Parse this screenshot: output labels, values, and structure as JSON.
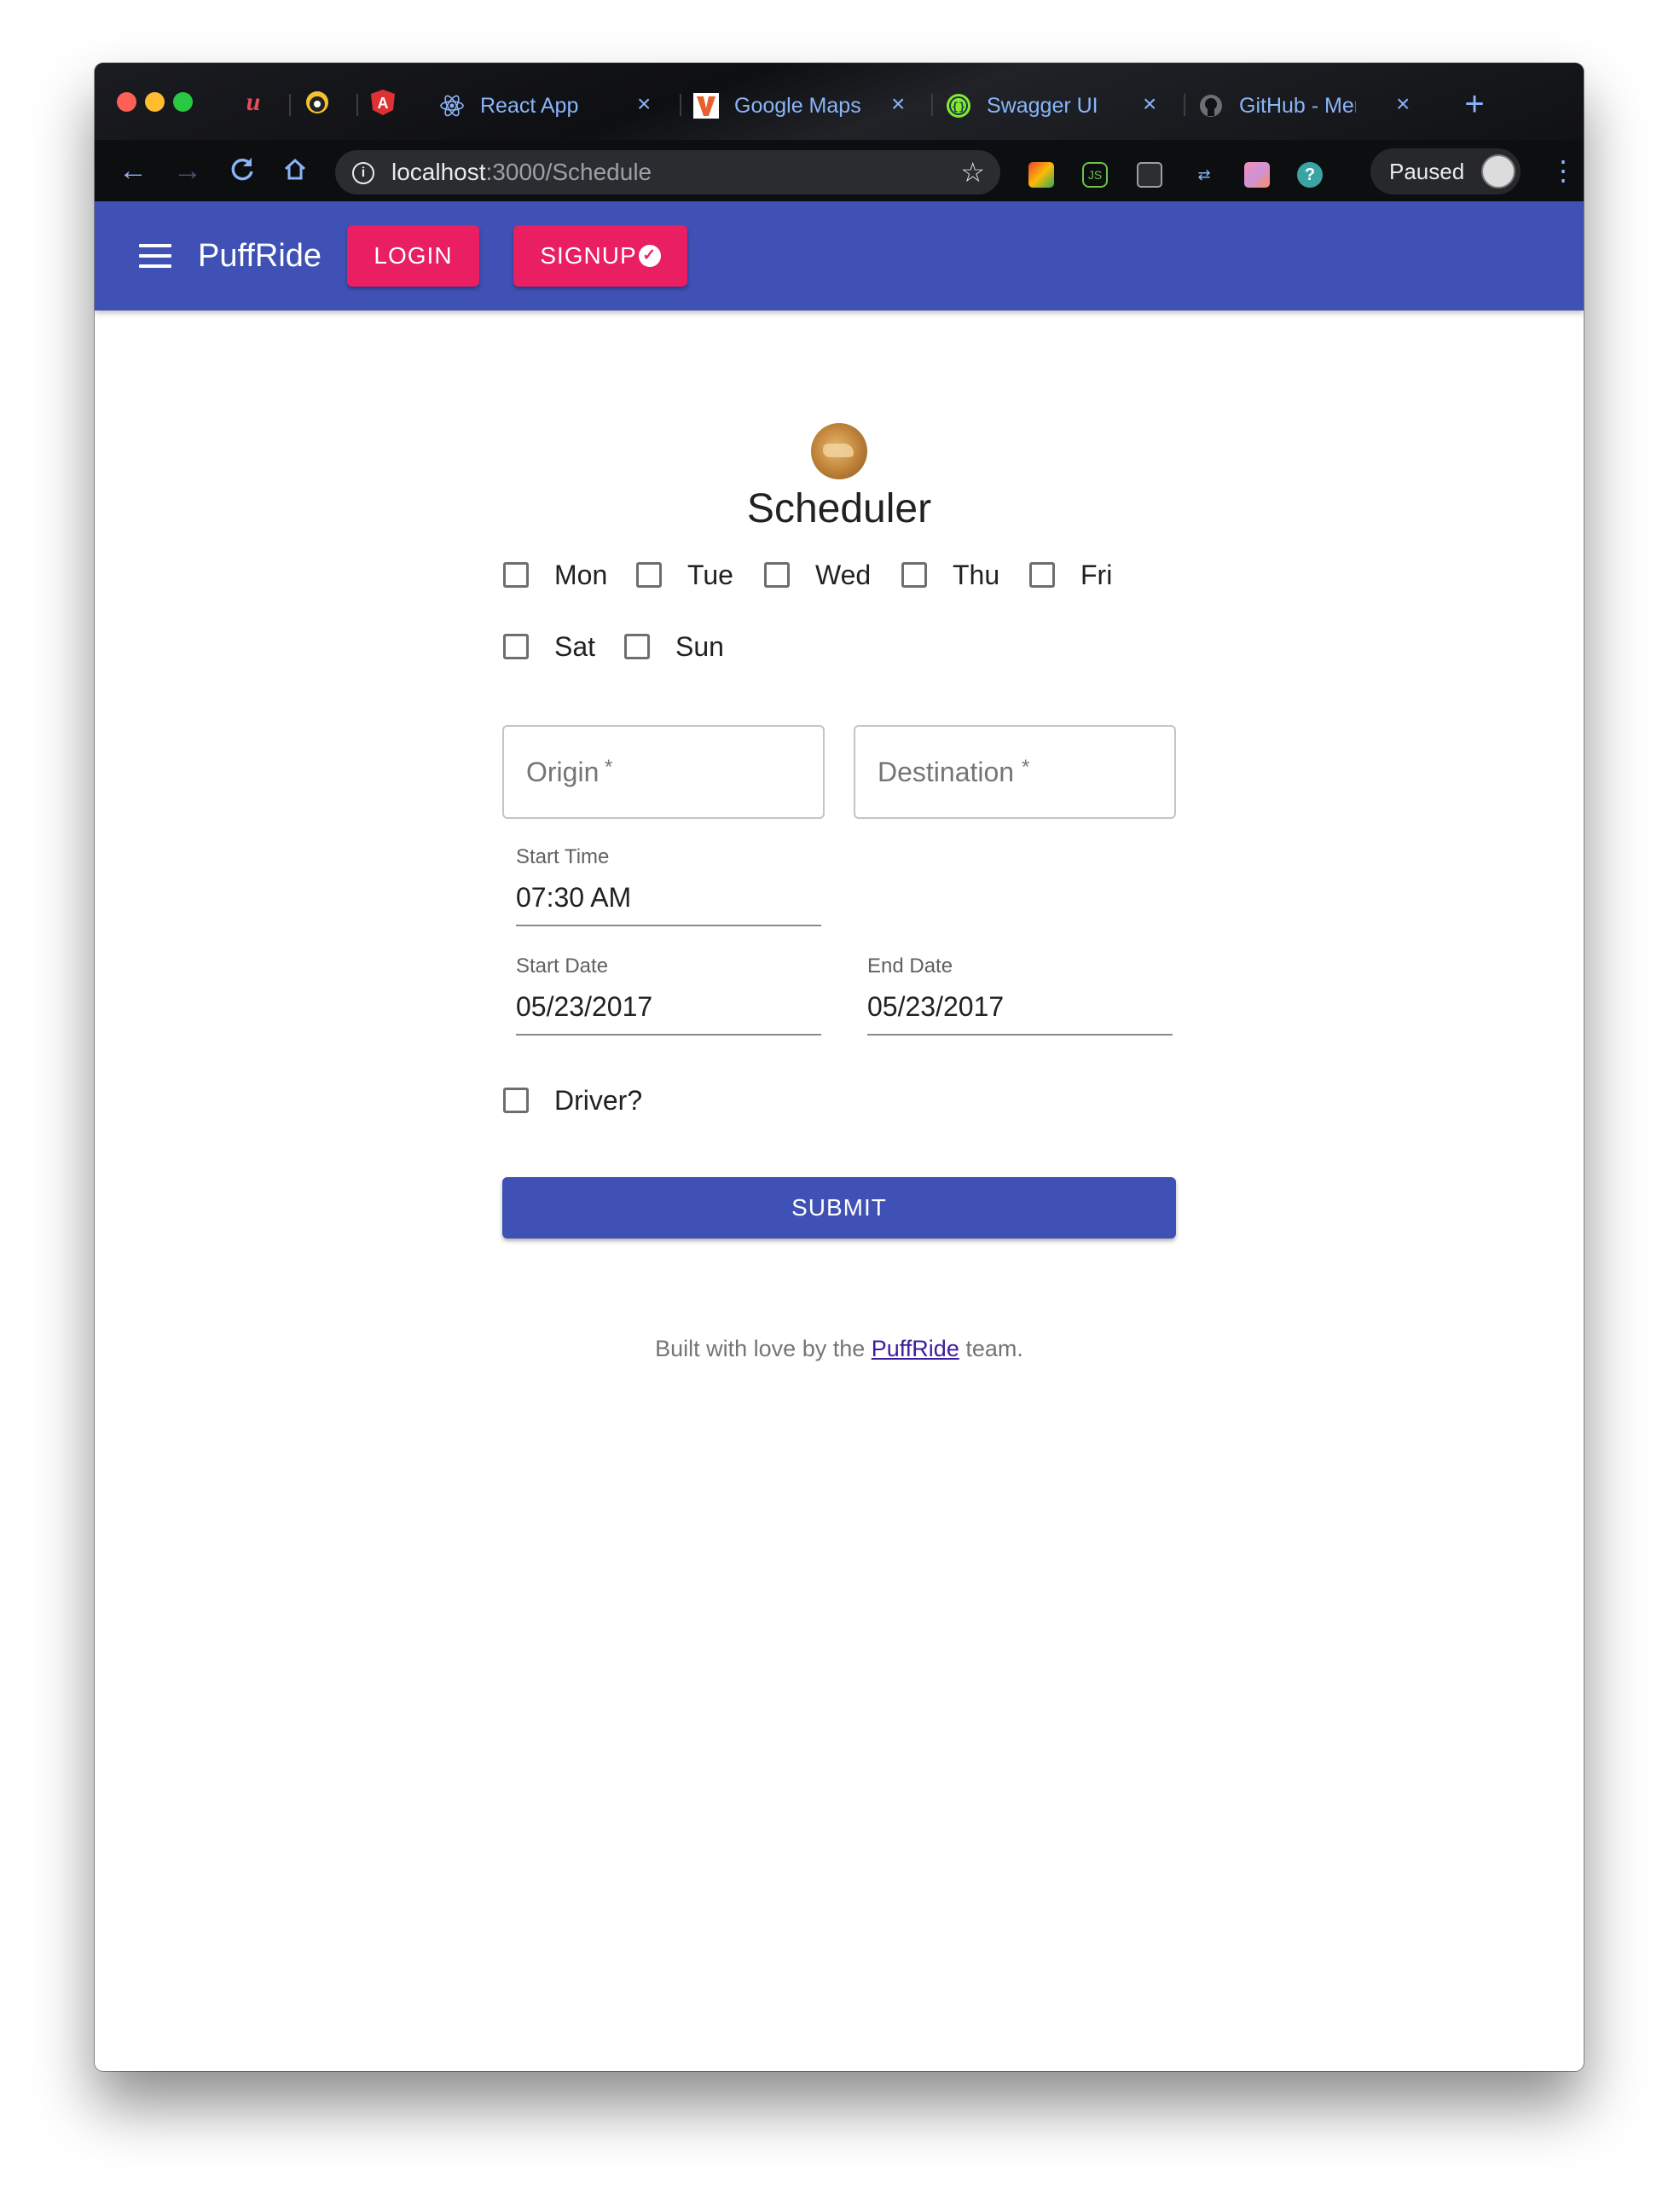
{
  "browser": {
    "tabs": [
      {
        "title": "React App",
        "favicon": "react-icon"
      },
      {
        "title": "Google Maps Platform",
        "favicon": "v-logo-icon"
      },
      {
        "title": "Swagger UI",
        "favicon": "swagger-icon"
      },
      {
        "title": "GitHub - Menk",
        "favicon": "github-icon"
      }
    ],
    "pinned_tabs": [
      "u-icon",
      "chick-icon",
      "angular-icon"
    ],
    "new_tab_glyph": "+",
    "close_glyph": "×",
    "url_host": "localhost",
    "url_path": ":3000/Schedule",
    "profile_label": "Paused",
    "accent_color": "#8ab4f8"
  },
  "app": {
    "brand": "PuffRide",
    "login_label": "LOGIN",
    "signup_label": "SIGNUP",
    "primary_color": "#3f51b5",
    "secondary_color": "#e91e63"
  },
  "form": {
    "title": "Scheduler",
    "days": [
      {
        "label": "Mon",
        "checked": false
      },
      {
        "label": "Tue",
        "checked": false
      },
      {
        "label": "Wed",
        "checked": false
      },
      {
        "label": "Thu",
        "checked": false
      },
      {
        "label": "Fri",
        "checked": false
      },
      {
        "label": "Sat",
        "checked": false
      },
      {
        "label": "Sun",
        "checked": false
      }
    ],
    "origin_placeholder": "Origin",
    "destination_placeholder": "Destination",
    "required_mark": "*",
    "start_time_label": "Start Time",
    "start_time_value": "07:30 AM",
    "start_date_label": "Start Date",
    "start_date_value": "05/23/2017",
    "end_date_label": "End Date",
    "end_date_value": "05/23/2017",
    "driver_label": "Driver?",
    "driver_checked": false,
    "submit_label": "SUBMIT"
  },
  "footer": {
    "prefix": "Built with love by the ",
    "link_text": "PuffRide",
    "suffix": " team."
  }
}
